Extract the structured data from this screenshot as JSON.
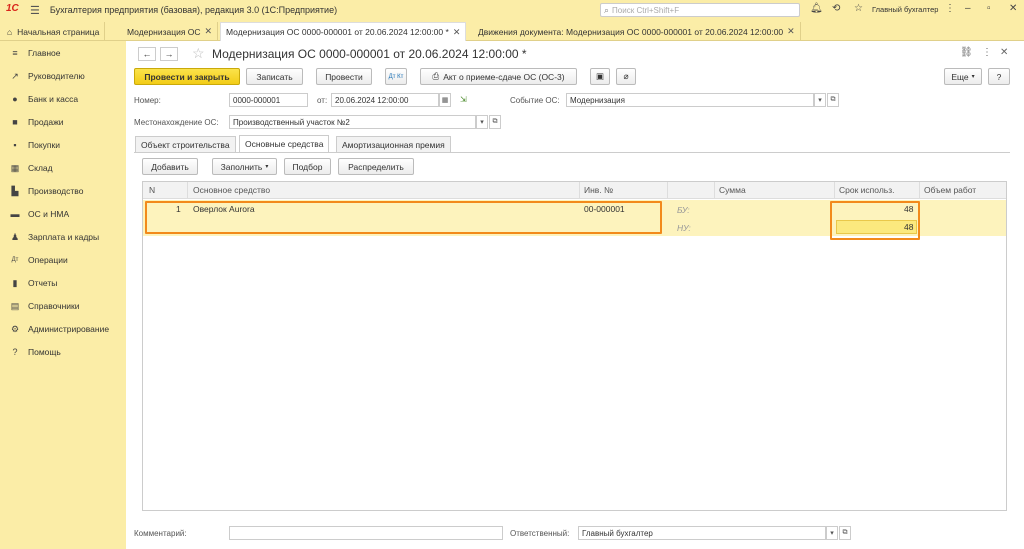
{
  "app": {
    "title": "Бухгалтерия предприятия (базовая), редакция 3.0  (1С:Предприятие)",
    "search_placeholder": "Поиск Ctrl+Shift+F",
    "user": "Главный бухгалтер"
  },
  "window_tabs": [
    {
      "label": "Начальная страница"
    },
    {
      "label": "Модернизация ОС"
    },
    {
      "label": "Модернизация ОС 0000-000001 от 20.06.2024 12:00:00 *"
    },
    {
      "label": "Движения документа: Модернизация ОС 0000-000001 от 20.06.2024 12:00:00"
    }
  ],
  "sidebar": {
    "items": [
      {
        "label": "Главное"
      },
      {
        "label": "Руководителю"
      },
      {
        "label": "Банк и касса"
      },
      {
        "label": "Продажи"
      },
      {
        "label": "Покупки"
      },
      {
        "label": "Склад"
      },
      {
        "label": "Производство"
      },
      {
        "label": "ОС и НМА"
      },
      {
        "label": "Зарплата и кадры"
      },
      {
        "label": "Операции"
      },
      {
        "label": "Отчеты"
      },
      {
        "label": "Справочники"
      },
      {
        "label": "Администрирование"
      },
      {
        "label": "Помощь"
      }
    ]
  },
  "document": {
    "title": "Модернизация ОС 0000-000001 от 20.06.2024 12:00:00 *"
  },
  "toolbar": {
    "post_close": "Провести и закрыть",
    "save": "Записать",
    "post": "Провести",
    "dtkt": "Дт Кт",
    "print_act": "Акт о приеме-сдаче ОС (ОС-3)",
    "more": "Еще",
    "help": "?"
  },
  "form": {
    "number_label": "Номер:",
    "number_value": "0000-000001",
    "date_label": "от:",
    "date_value": "20.06.2024 12:00:00",
    "event_label": "Событие ОС:",
    "event_value": "Модернизация",
    "location_label": "Местонахождение ОС:",
    "location_value": "Производственный участок №2"
  },
  "form_tabs": [
    {
      "label": "Объект строительства"
    },
    {
      "label": "Основные средства"
    },
    {
      "label": "Амортизационная премия"
    }
  ],
  "table_toolbar": {
    "add": "Добавить",
    "fill": "Заполнить",
    "pick": "Подбор",
    "distribute": "Распределить"
  },
  "table": {
    "headers": [
      "N",
      "Основное средство",
      "Инв. №",
      "",
      "Сумма",
      "Срок использ.",
      "Объем работ"
    ],
    "rows": [
      {
        "n": "1",
        "asset": "Оверлок Aurora",
        "inv": "00-000001",
        "bu_label": "БУ:",
        "nu_label": "НУ:",
        "term_bu": "48",
        "term_nu": "48"
      }
    ]
  },
  "footer": {
    "comment_label": "Комментарий:",
    "comment_value": "",
    "responsible_label": "Ответственный:",
    "responsible_value": "Главный бухгалтер"
  },
  "colors": {
    "sidebar_bg": "#fbeda7",
    "highlight": "#f28a1b",
    "primary_button": "#f2cc17",
    "row_selected": "#fdf3bd"
  }
}
